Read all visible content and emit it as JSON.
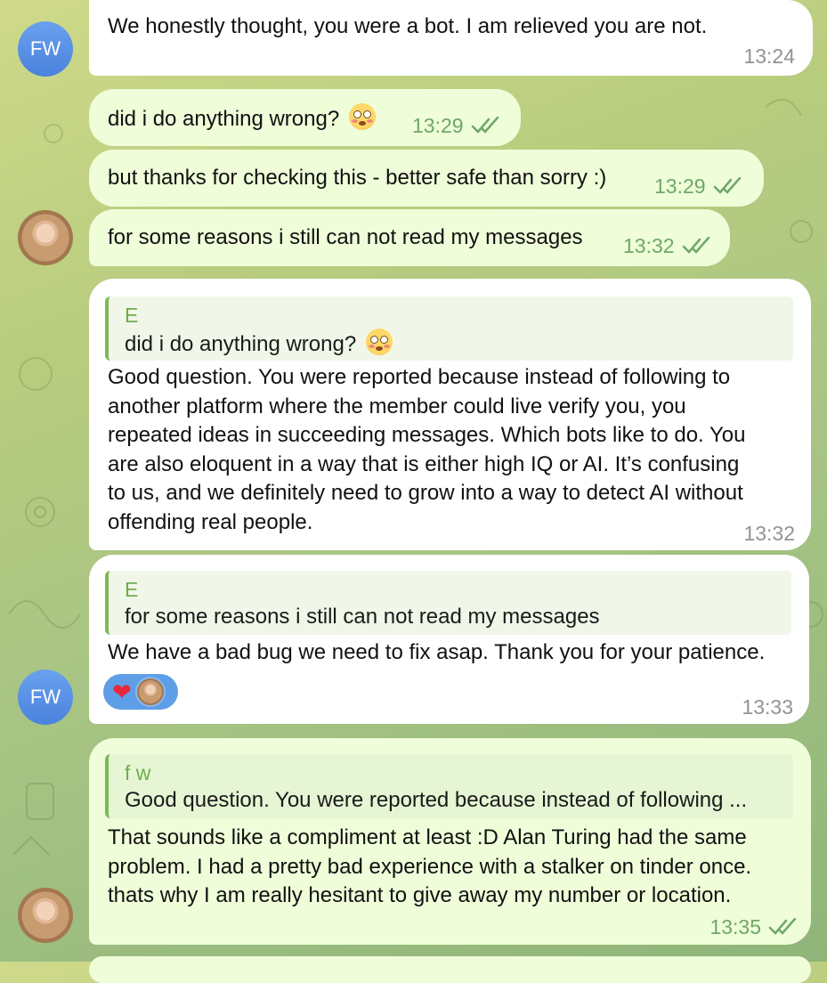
{
  "chat": {
    "avatars": {
      "fw_initials": "FW"
    },
    "messages": [
      {
        "id": "m1",
        "direction": "in",
        "text": "We honestly thought, you were a bot. I am relieved you are not.",
        "time": "13:24"
      },
      {
        "id": "m2",
        "direction": "out",
        "text": "did i do anything wrong?",
        "emoji": "flushed-face",
        "time": "13:29",
        "status": "read"
      },
      {
        "id": "m3",
        "direction": "out",
        "text": "but thanks for checking this - better safe than sorry :)",
        "time": "13:29",
        "status": "read"
      },
      {
        "id": "m4",
        "direction": "out",
        "text": "for some reasons i still can not read my messages",
        "time": "13:32",
        "status": "read"
      },
      {
        "id": "m5",
        "direction": "in",
        "reply": {
          "name": "E",
          "text": "did i do anything wrong?",
          "emoji": "flushed-face"
        },
        "lines": [
          "Good question. You were reported because instead of following to",
          "another platform where the member could live verify you, you",
          "repeated ideas in succeeding messages. Which bots like to do. You",
          "are also eloquent in a way that is either high IQ or AI. It’s confusing",
          "to us, and we definitely need to grow into a way to detect AI without",
          "offending real people."
        ],
        "time": "13:32"
      },
      {
        "id": "m6",
        "direction": "in",
        "reply": {
          "name": "E",
          "text": "for some reasons i still can not read my messages"
        },
        "text": "We have a bad bug we need to fix asap. Thank you for your patience.",
        "reactions": [
          "heart"
        ],
        "time": "13:33"
      },
      {
        "id": "m7",
        "direction": "out",
        "reply": {
          "name": "f w",
          "text": "Good question. You were reported because instead of following ..."
        },
        "lines": [
          "That sounds like a compliment at least :D Alan Turing had the same",
          "problem. I had a pretty bad experience with a stalker on tinder once.",
          "thats why I am really hesitant to give away my number or location."
        ],
        "time": "13:35",
        "status": "read"
      }
    ]
  },
  "colors": {
    "incoming_bubble": "#ffffff",
    "outgoing_bubble": "#effdd9",
    "reply_accent": "#7cb955",
    "read_check": "#6ea868",
    "reaction_pill": "#5e9ee6"
  }
}
